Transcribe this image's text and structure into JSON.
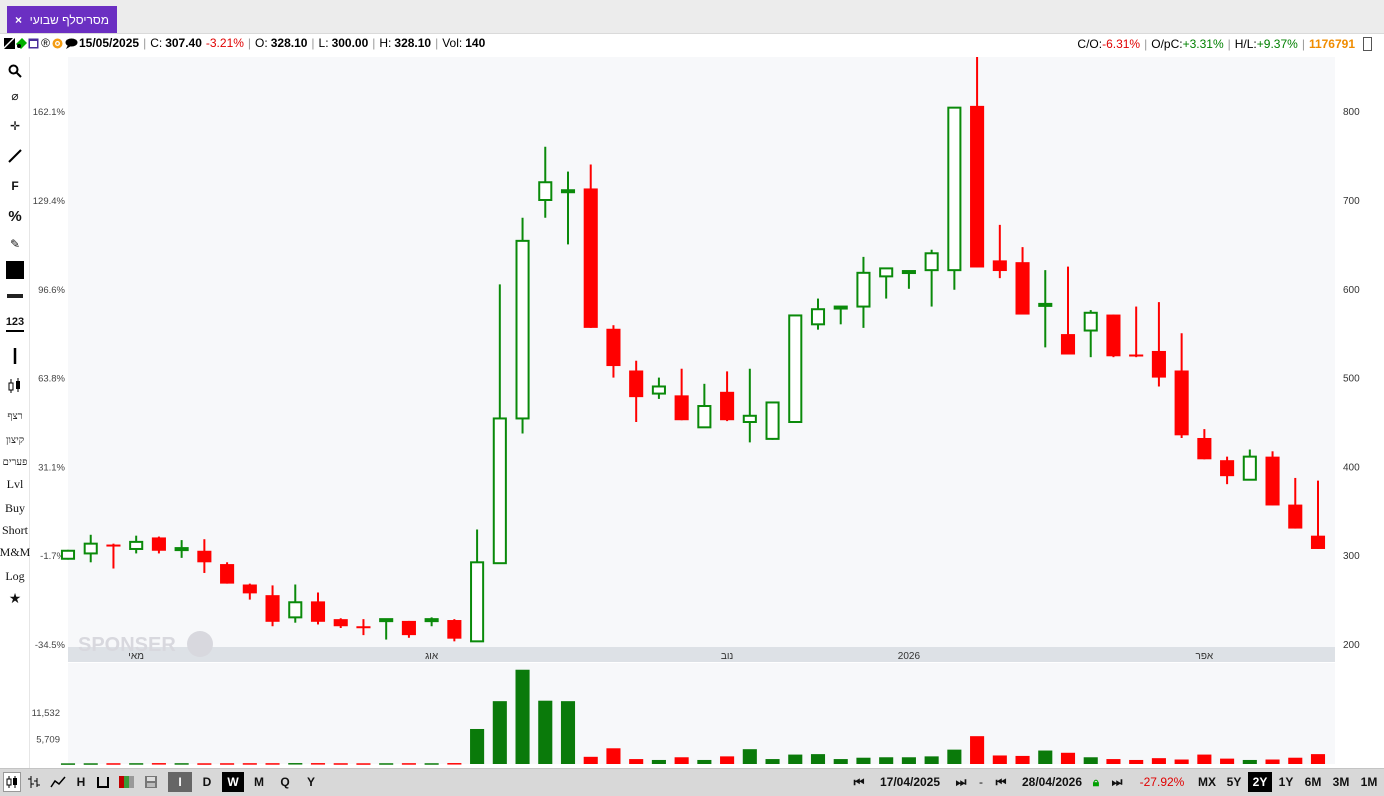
{
  "tab": {
    "title": "מסריסלף שבועי",
    "close_label": "×"
  },
  "info": {
    "date": "15/05/2025",
    "c_label": "C:",
    "c_value": "307.40",
    "c_change": "-3.21%",
    "o_label": "O:",
    "o_value": "328.10",
    "l_label": "L:",
    "l_value": "300.00",
    "h_label": "H:",
    "h_value": "328.10",
    "vol_label": "Vol:",
    "vol_value": "140",
    "co_label": "C/O:",
    "co_value": "-6.31%",
    "opc_label": "O/pC:",
    "opc_value": "+3.31%",
    "hl_label": "H/L:",
    "hl_value": "+9.37%",
    "symbol_id": "1176791",
    "icons": [
      "share-icon",
      "color-icon",
      "r-icon",
      "target-icon",
      "comment-icon"
    ]
  },
  "tools": [
    {
      "name": "search-icon",
      "glyph": "⚲"
    },
    {
      "name": "eraser-icon",
      "glyph": "⌀"
    },
    {
      "name": "crosshair-icon",
      "glyph": "✛"
    },
    {
      "name": "line-icon",
      "glyph": "╱"
    },
    {
      "name": "fibonacci-tool",
      "glyph": "F"
    },
    {
      "name": "percent-tool",
      "glyph": "%"
    },
    {
      "name": "edit-icon",
      "glyph": "✎"
    },
    {
      "name": "color-swatch",
      "glyph": "■"
    },
    {
      "name": "thickness-icon",
      "glyph": "▬"
    },
    {
      "name": "number-tool",
      "glyph": "123"
    },
    {
      "name": "vertical-line-icon",
      "glyph": "┃"
    },
    {
      "name": "candle-icon",
      "glyph": "⫾"
    },
    {
      "name": "tool-retzef",
      "glyph": "רצף"
    },
    {
      "name": "tool-kitzon",
      "glyph": "קיצון"
    },
    {
      "name": "tool-pearim",
      "glyph": "פערים"
    },
    {
      "name": "tool-lvl",
      "glyph": "Lvl"
    },
    {
      "name": "tool-buy",
      "glyph": "Buy"
    },
    {
      "name": "tool-short",
      "glyph": "Short"
    },
    {
      "name": "tool-mm",
      "glyph": "M&M"
    },
    {
      "name": "tool-log",
      "glyph": "Log"
    },
    {
      "name": "star-icon",
      "glyph": "★"
    }
  ],
  "watermark": "SPONSER",
  "chart_data": {
    "type": "candlestick",
    "interval": "weekly",
    "right_axis": {
      "ticks": [
        200,
        300,
        400,
        500,
        600,
        700,
        800
      ]
    },
    "left_axis": {
      "ticks": [
        "162.1%",
        "129.4%",
        "96.6%",
        "63.8%",
        "31.1%",
        "-1.7%",
        "-34.5%"
      ]
    },
    "x_month_labels": [
      {
        "label": "מאי",
        "index": 3
      },
      {
        "label": "אוג",
        "index": 16
      },
      {
        "label": "נוב",
        "index": 29
      },
      {
        "label": "2026",
        "index": 37
      },
      {
        "label": "אפר",
        "index": 50
      }
    ],
    "volume_axis": {
      "ticks": [
        "11,532",
        "5,709"
      ]
    },
    "candles": [
      {
        "o": 296,
        "h": 306,
        "l": 295,
        "c": 305
      },
      {
        "o": 302,
        "h": 323,
        "l": 292,
        "c": 313
      },
      {
        "o": 312,
        "h": 313,
        "l": 285,
        "c": 310
      },
      {
        "o": 307,
        "h": 322,
        "l": 302,
        "c": 315
      },
      {
        "o": 320,
        "h": 321,
        "l": 302,
        "c": 305
      },
      {
        "o": 308,
        "h": 317,
        "l": 297,
        "c": 308
      },
      {
        "o": 305,
        "h": 318,
        "l": 280,
        "c": 292
      },
      {
        "o": 290,
        "h": 292,
        "l": 268,
        "c": 268
      },
      {
        "o": 267,
        "h": 268,
        "l": 250,
        "c": 257
      },
      {
        "o": 255,
        "h": 266,
        "l": 220,
        "c": 225
      },
      {
        "o": 230,
        "h": 267,
        "l": 224,
        "c": 247
      },
      {
        "o": 248,
        "h": 258,
        "l": 222,
        "c": 225
      },
      {
        "o": 228,
        "h": 229,
        "l": 218,
        "c": 220
      },
      {
        "o": 220,
        "h": 228,
        "l": 210,
        "c": 219
      },
      {
        "o": 227,
        "h": 228,
        "l": 205,
        "c": 228
      },
      {
        "o": 226,
        "h": 226,
        "l": 207,
        "c": 210
      },
      {
        "o": 226,
        "h": 230,
        "l": 220,
        "c": 228
      },
      {
        "o": 227,
        "h": 228,
        "l": 203,
        "c": 206
      },
      {
        "o": 203,
        "h": 329,
        "l": 203,
        "c": 292
      },
      {
        "o": 291,
        "h": 605,
        "l": 292,
        "c": 454
      },
      {
        "o": 454,
        "h": 680,
        "l": 437,
        "c": 654
      },
      {
        "o": 700,
        "h": 760,
        "l": 680,
        "c": 720
      },
      {
        "o": 711,
        "h": 732,
        "l": 650,
        "c": 711
      },
      {
        "o": 713,
        "h": 740,
        "l": 556,
        "c": 556
      },
      {
        "o": 555,
        "h": 559,
        "l": 500,
        "c": 513
      },
      {
        "o": 508,
        "h": 519,
        "l": 450,
        "c": 478
      },
      {
        "o": 482,
        "h": 500,
        "l": 476,
        "c": 490
      },
      {
        "o": 480,
        "h": 510,
        "l": 452,
        "c": 452
      },
      {
        "o": 444,
        "h": 493,
        "l": 445,
        "c": 468
      },
      {
        "o": 484,
        "h": 507,
        "l": 451,
        "c": 452
      },
      {
        "o": 450,
        "h": 510,
        "l": 427,
        "c": 457
      },
      {
        "o": 431,
        "h": 460,
        "l": 430,
        "c": 472
      },
      {
        "o": 450,
        "h": 567,
        "l": 452,
        "c": 570
      },
      {
        "o": 560,
        "h": 589,
        "l": 554,
        "c": 577
      },
      {
        "o": 578,
        "h": 580,
        "l": 560,
        "c": 580
      },
      {
        "o": 580,
        "h": 636,
        "l": 556,
        "c": 618
      },
      {
        "o": 614,
        "h": 620,
        "l": 589,
        "c": 623
      },
      {
        "o": 620,
        "h": 617,
        "l": 600,
        "c": 620
      },
      {
        "o": 621,
        "h": 644,
        "l": 580,
        "c": 640
      },
      {
        "o": 621,
        "h": 653,
        "l": 599,
        "c": 804
      },
      {
        "o": 806,
        "h": 870,
        "l": 655,
        "c": 624
      },
      {
        "o": 632,
        "h": 672,
        "l": 612,
        "c": 620
      },
      {
        "o": 630,
        "h": 647,
        "l": 571,
        "c": 571
      },
      {
        "o": 581,
        "h": 621,
        "l": 534,
        "c": 583
      },
      {
        "o": 549,
        "h": 625,
        "l": 531,
        "c": 526
      },
      {
        "o": 553,
        "h": 576,
        "l": 523,
        "c": 573
      },
      {
        "o": 571,
        "h": 560,
        "l": 523,
        "c": 524
      },
      {
        "o": 526,
        "h": 580,
        "l": 523,
        "c": 525
      },
      {
        "o": 530,
        "h": 585,
        "l": 490,
        "c": 500
      },
      {
        "o": 508,
        "h": 550,
        "l": 432,
        "c": 435
      },
      {
        "o": 432,
        "h": 442,
        "l": 410,
        "c": 408
      },
      {
        "o": 407,
        "h": 411,
        "l": 380,
        "c": 389
      },
      {
        "o": 385,
        "h": 419,
        "l": 389,
        "c": 411
      },
      {
        "o": 411,
        "h": 417,
        "l": 356,
        "c": 356
      },
      {
        "o": 357,
        "h": 387,
        "l": 343,
        "c": 330
      },
      {
        "o": 322,
        "h": 384,
        "l": 315,
        "c": 307
      }
    ],
    "volumes": [
      150,
      160,
      170,
      180,
      200,
      180,
      160,
      170,
      180,
      180,
      210,
      200,
      170,
      160,
      170,
      180,
      170,
      210,
      7800,
      14000,
      21000,
      14100,
      14000,
      1600,
      3500,
      1100,
      900,
      1500,
      900,
      1700,
      3300,
      1100,
      2100,
      2200,
      1100,
      1400,
      1500,
      1500,
      1700,
      3200,
      6200,
      1900,
      1800,
      3000,
      2500,
      1500,
      1100,
      900,
      1300,
      1000,
      2100,
      1200,
      900,
      1000,
      1400,
      2200
    ]
  },
  "bottom": {
    "chart_types": [
      "candle-type-icon",
      "ohlc-type-icon",
      "line-type-icon",
      "hl-type-icon",
      "bar-type-icon",
      "volume-color-icon",
      "save-icon"
    ],
    "h_label": "H",
    "intervals": [
      "D",
      "W",
      "M",
      "Q",
      "Y"
    ],
    "selected_interval": "W",
    "start_date": "17/04/2025",
    "dash": "-",
    "end_date": "28/04/2026",
    "range_change": "-27.92%",
    "ranges": [
      "MX",
      "5Y",
      "2Y",
      "1Y",
      "6M",
      "3M",
      "1M"
    ],
    "selected_range": "2Y",
    "indicator_label": "I"
  }
}
